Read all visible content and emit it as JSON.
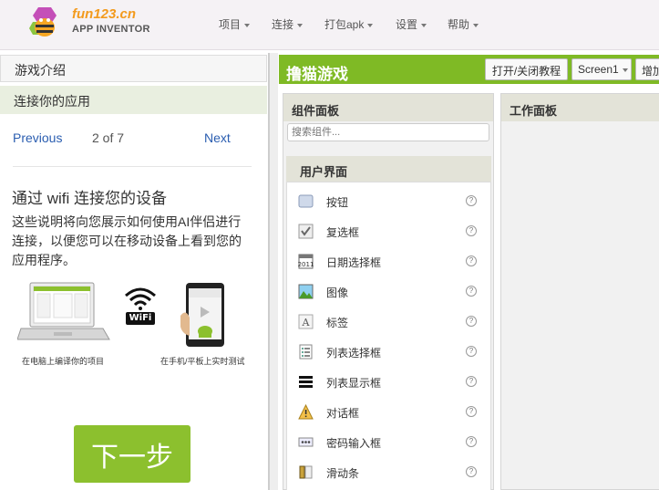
{
  "header": {
    "logo_title": "fun123.cn",
    "logo_subtitle": "APP INVENTOR",
    "menu": [
      "项目",
      "连接",
      "打包apk",
      "设置",
      "帮助"
    ]
  },
  "tutorial": {
    "title": "游戏介绍",
    "subtitle": "连接你的应用",
    "previous": "Previous",
    "page": "2 of 7",
    "next": "Next",
    "heading": "通过 wifi 连接您的设备",
    "body": "这些说明将向您展示如何使用AI伴侣进行连接，以便您可以在移动设备上看到您的应用程序。",
    "wifi_label": "WiFi",
    "caption_computer": "在电脑上编译你的项目",
    "caption_phone": "在手机/平板上实时测试",
    "next_step": "下一步"
  },
  "designer": {
    "project_name": "撸猫游戏",
    "toggle_tutorial": "打开/关闭教程",
    "screen_select": "Screen1",
    "add_screen": "增加屏幕"
  },
  "palette": {
    "title": "组件面板",
    "search_placeholder": "搜索组件...",
    "category": "用户界面",
    "help_glyph": "?",
    "items": [
      {
        "label": "按钮",
        "icon": "button-icon"
      },
      {
        "label": "复选框",
        "icon": "checkbox-icon"
      },
      {
        "label": "日期选择框",
        "icon": "calendar-icon"
      },
      {
        "label": "图像",
        "icon": "image-icon"
      },
      {
        "label": "标签",
        "icon": "label-icon"
      },
      {
        "label": "列表选择框",
        "icon": "list-picker-icon"
      },
      {
        "label": "列表显示框",
        "icon": "list-view-icon"
      },
      {
        "label": "对话框",
        "icon": "warning-icon"
      },
      {
        "label": "密码输入框",
        "icon": "password-icon"
      },
      {
        "label": "滑动条",
        "icon": "slider-icon"
      }
    ]
  },
  "viewer": {
    "title": "工作面板"
  },
  "colors": {
    "accent": "#7fba25",
    "next_button": "#8cc02e",
    "link": "#2a5db0",
    "logo": "#f39a1c"
  }
}
